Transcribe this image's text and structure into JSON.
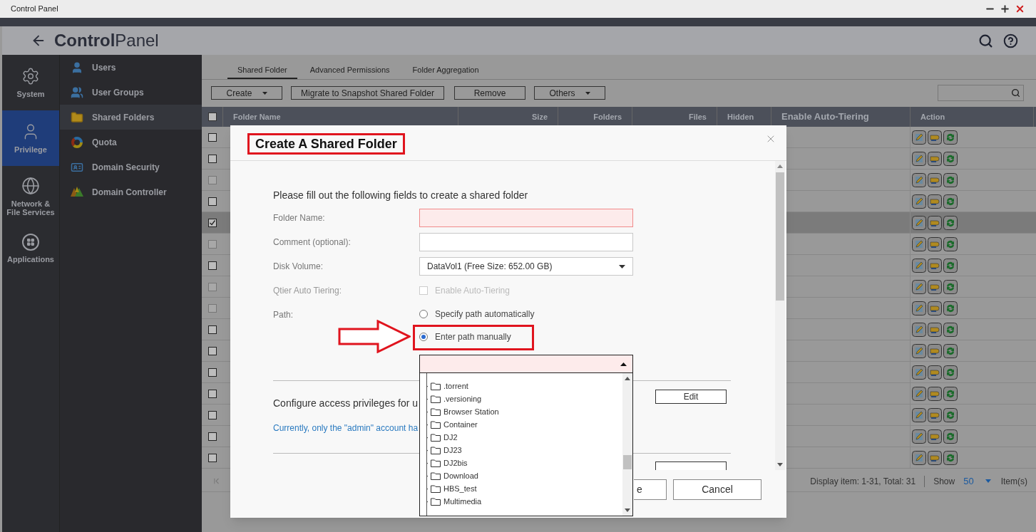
{
  "window": {
    "title": "Control Panel"
  },
  "header": {
    "title_bold": "Control",
    "title_light": "Panel"
  },
  "rail": [
    {
      "label": "System",
      "kind": "gear",
      "selected": false
    },
    {
      "label": "Privilege",
      "kind": "user",
      "selected": true
    },
    {
      "label": "Network &\nFile Services",
      "kind": "globe",
      "selected": false
    },
    {
      "label": "Applications",
      "kind": "apps",
      "selected": false
    }
  ],
  "menu": [
    {
      "label": "Users",
      "kind": "user",
      "selected": false
    },
    {
      "label": "User Groups",
      "kind": "group",
      "selected": false
    },
    {
      "label": "Shared Folders",
      "kind": "folder",
      "selected": true
    },
    {
      "label": "Quota",
      "kind": "quota",
      "selected": false
    },
    {
      "label": "Domain Security",
      "kind": "badge",
      "selected": false
    },
    {
      "label": "Domain Controller",
      "kind": "controller",
      "selected": false
    }
  ],
  "tabs": [
    {
      "label": "Shared Folder",
      "selected": true
    },
    {
      "label": "Advanced Permissions",
      "selected": false
    },
    {
      "label": "Folder Aggregation",
      "selected": false
    }
  ],
  "toolbar": [
    {
      "label": "Create",
      "dropdown": true
    },
    {
      "label": "Migrate to Snapshot Shared Folder",
      "dropdown": false
    },
    {
      "label": "Remove",
      "dropdown": false
    },
    {
      "label": "Others",
      "dropdown": true
    }
  ],
  "table": {
    "select_all": {
      "checked": false
    },
    "columns": [
      "Folder Name",
      "Size",
      "Folders",
      "Files",
      "Hidden",
      "Enable Auto-Tiering",
      "Action"
    ],
    "rows": [
      {
        "checked": false,
        "disabled": false,
        "selected": false
      },
      {
        "checked": false,
        "disabled": false,
        "selected": false
      },
      {
        "checked": false,
        "disabled": true,
        "selected": false
      },
      {
        "checked": false,
        "disabled": false,
        "selected": false
      },
      {
        "checked": true,
        "disabled": false,
        "selected": true
      },
      {
        "checked": false,
        "disabled": true,
        "selected": false
      },
      {
        "checked": false,
        "disabled": false,
        "selected": false
      },
      {
        "checked": false,
        "disabled": true,
        "selected": false
      },
      {
        "checked": false,
        "disabled": true,
        "selected": false
      },
      {
        "checked": false,
        "disabled": false,
        "selected": false
      },
      {
        "checked": false,
        "disabled": false,
        "selected": false
      },
      {
        "checked": false,
        "disabled": false,
        "selected": false
      },
      {
        "checked": false,
        "disabled": false,
        "selected": false
      },
      {
        "checked": false,
        "disabled": false,
        "selected": false
      },
      {
        "checked": false,
        "disabled": false,
        "selected": false
      },
      {
        "checked": false,
        "disabled": false,
        "selected": false
      }
    ]
  },
  "pager": {
    "summary": "Display item: 1-31, Total: 31",
    "show_label": "Show",
    "page_size": "50",
    "unit": "Item(s)"
  },
  "dialog": {
    "title": "Create A Shared Folder",
    "intro": "Please fill out the following fields to create a shared folder",
    "fields": [
      {
        "label": "Folder Name:",
        "kind": "text",
        "invalid": true
      },
      {
        "label": "Comment (optional):",
        "kind": "text",
        "invalid": false
      },
      {
        "label": "Disk Volume:",
        "kind": "select",
        "value": "DataVol1 (Free Size: 652.00 GB)"
      },
      {
        "label": "Qtier Auto Tiering:",
        "kind": "checkbox",
        "option": "Enable Auto-Tiering",
        "checked": false,
        "disabled": true
      },
      {
        "label": "Path:",
        "kind": "radio",
        "options": [
          {
            "label": "Specify path automatically",
            "selected": false
          },
          {
            "label": "Enter path manually",
            "selected": true
          }
        ]
      }
    ],
    "path_tree": [
      ".torrent",
      ".versioning",
      "Browser Station",
      "Container",
      "DJ2",
      "DJ23",
      "DJ2bis",
      "Download",
      "HBS_test",
      "Multimedia"
    ],
    "privileges": {
      "heading": "Configure access privileges for u",
      "note": "Currently, only the \"admin\" account ha",
      "button": "Edit"
    },
    "footer_buttons": [
      "e",
      "Cancel"
    ]
  }
}
